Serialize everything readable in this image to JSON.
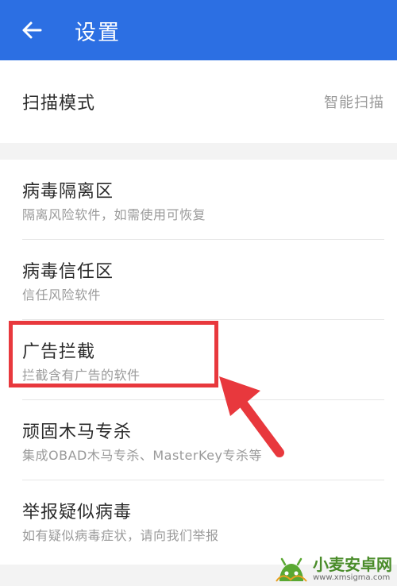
{
  "header": {
    "back_icon": "arrow-left-icon",
    "title": "设置"
  },
  "scan": {
    "label": "扫描模式",
    "value": "智能扫描"
  },
  "items": [
    {
      "title": "病毒隔离区",
      "subtitle": "隔离风险软件，如需使用可恢复"
    },
    {
      "title": "病毒信任区",
      "subtitle": "信任风险软件"
    },
    {
      "title": "广告拦截",
      "subtitle": "拦截含有广告的软件"
    },
    {
      "title": "顽固木马专杀",
      "subtitle": "集成OBAD木马专杀、MasterKey专杀等"
    },
    {
      "title": "举报疑似病毒",
      "subtitle": "如有疑似病毒症状，请向我们举报"
    }
  ],
  "annotation": {
    "highlight_color": "#e8383d",
    "arrow_icon": "red-arrow-pointing-icon"
  },
  "watermark": {
    "title": "小麦安卓网",
    "url": "www.xmsigma.com"
  },
  "colors": {
    "appbar": "#2c6fe3",
    "background": "#f3f3f3"
  }
}
